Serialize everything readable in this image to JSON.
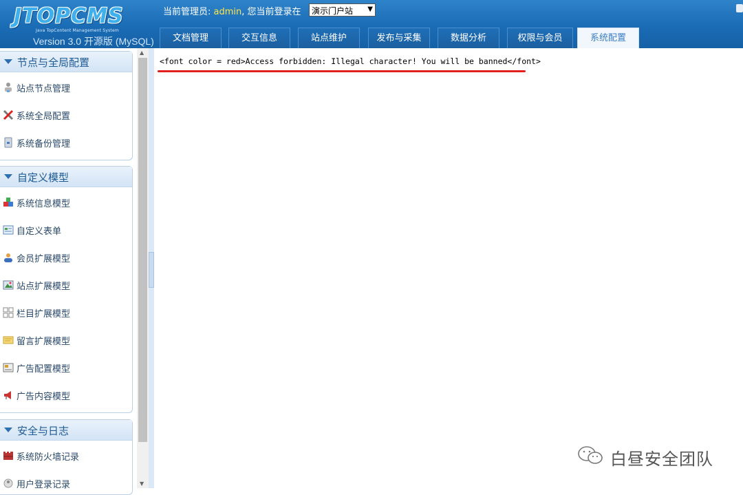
{
  "header": {
    "logo_text": "JTOPCMS",
    "logo_subtitle": "Java TopContent Management System",
    "version": "Version 3.0  开源版 (MySQL)",
    "admin_label": "当前管理员: ",
    "admin_name": "admin",
    "login_site_label": ",  您当前登录在",
    "site_select_value": "演示门户站"
  },
  "tabs": [
    {
      "label": "文档管理"
    },
    {
      "label": "交互信息"
    },
    {
      "label": "站点维护"
    },
    {
      "label": "发布与采集"
    },
    {
      "label": "数据分析"
    },
    {
      "label": "权限与会员"
    },
    {
      "label": "系统配置",
      "active": true
    }
  ],
  "sidebar": {
    "sections": [
      {
        "title": "节点与全局配置",
        "items": [
          {
            "label": "站点节点管理",
            "icon": "user-tree-icon"
          },
          {
            "label": "系统全局配置",
            "icon": "tools-icon"
          },
          {
            "label": "系统备份管理",
            "icon": "backup-icon"
          }
        ]
      },
      {
        "title": "自定义模型",
        "items": [
          {
            "label": "系统信息模型",
            "icon": "blocks-icon"
          },
          {
            "label": "自定义表单",
            "icon": "form-icon"
          },
          {
            "label": "会员扩展模型",
            "icon": "member-icon"
          },
          {
            "label": "站点扩展模型",
            "icon": "site-image-icon"
          },
          {
            "label": "栏目扩展模型",
            "icon": "grid-icon"
          },
          {
            "label": "留言扩展模型",
            "icon": "note-icon"
          },
          {
            "label": "广告配置模型",
            "icon": "ad-config-icon"
          },
          {
            "label": "广告内容模型",
            "icon": "megaphone-icon"
          }
        ]
      },
      {
        "title": "安全与日志",
        "items": [
          {
            "label": "系统防火墙记录",
            "icon": "firewall-icon"
          },
          {
            "label": "用户登录记录",
            "icon": "login-record-icon"
          }
        ]
      }
    ]
  },
  "main": {
    "message": "<font color = red>Access forbidden: Illegal character! You will be banned</font>"
  },
  "watermark": {
    "text": "白昼安全团队"
  },
  "colors": {
    "header_blue": "#1a6cb5",
    "admin_name": "#ffe44a",
    "underline_red": "#e0201c",
    "sidebar_title": "#1e5a96"
  }
}
